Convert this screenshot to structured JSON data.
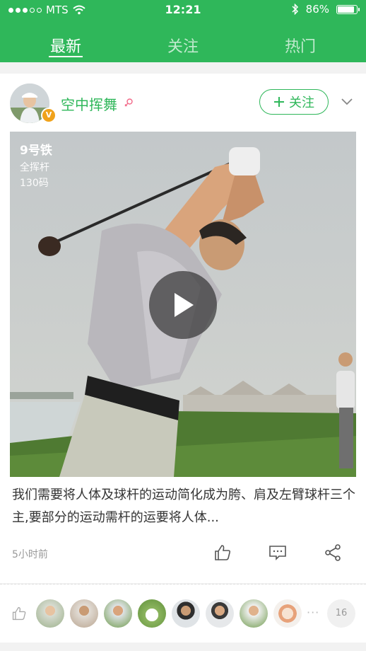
{
  "status_bar": {
    "carrier": "MTS",
    "time": "12:21",
    "battery": "86%",
    "battery_level": 0.86,
    "icons": [
      "signal-dots-icon",
      "wifi-icon",
      "bluetooth-icon",
      "battery-icon"
    ]
  },
  "tabs": [
    {
      "label": "最新",
      "active": true
    },
    {
      "label": "关注",
      "active": false
    },
    {
      "label": "热门",
      "active": false
    }
  ],
  "post": {
    "username": "空中挥舞",
    "verified_badge": "V",
    "follow_label": "关注",
    "media": {
      "title": "9号铁",
      "subtitle_1": "全挥杆",
      "subtitle_2": "130码"
    },
    "text": "我们需要将人体及球杆的运动简化成为胯、肩及左臂球杆三个主,要部分的运动需杆的运要将人体...",
    "time": "5小时前",
    "actions": [
      "thumbs-up-icon",
      "comment-icon",
      "share-icon"
    ],
    "like_count": "16"
  },
  "colors": {
    "brand": "#2fb75a",
    "badge": "#f0a21b"
  }
}
